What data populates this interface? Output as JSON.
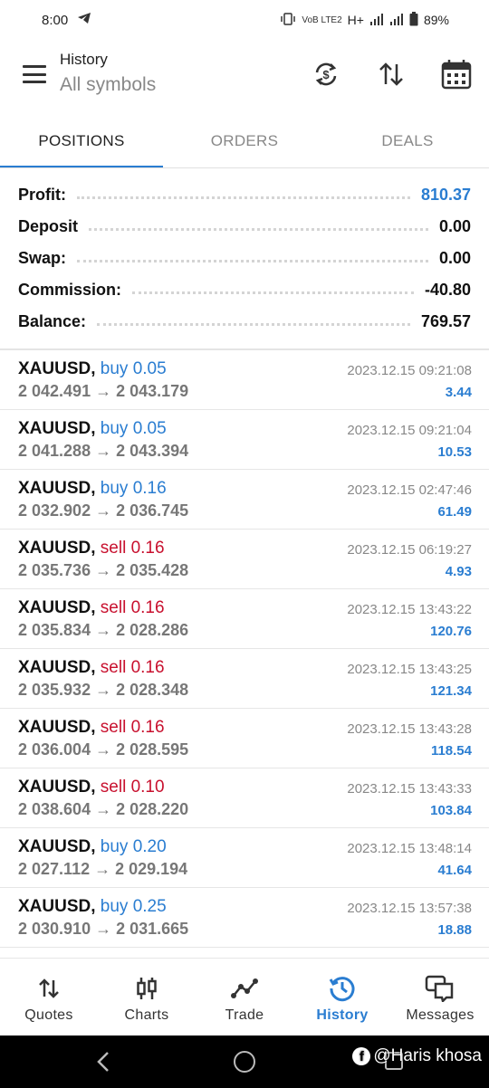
{
  "status_bar": {
    "time": "8:00",
    "net_small": "VoB LTE2",
    "net_type": "H+",
    "battery": "89%"
  },
  "header": {
    "title": "History",
    "subtitle": "All symbols"
  },
  "tabs": [
    {
      "label": "POSITIONS",
      "active": true
    },
    {
      "label": "ORDERS",
      "active": false
    },
    {
      "label": "DEALS",
      "active": false
    }
  ],
  "summary": {
    "profit": {
      "label": "Profit:",
      "value": "810.37"
    },
    "deposit": {
      "label": "Deposit",
      "value": "0.00"
    },
    "swap": {
      "label": "Swap:",
      "value": "0.00"
    },
    "commission": {
      "label": "Commission:",
      "value": "-40.80"
    },
    "balance": {
      "label": "Balance:",
      "value": "769.57"
    }
  },
  "positions": [
    {
      "symbol": "XAUUSD,",
      "side": "buy 0.05",
      "prices": "2 042.491 → 2 043.179",
      "time": "2023.12.15 09:21:08",
      "profit": "3.44"
    },
    {
      "symbol": "XAUUSD,",
      "side": "buy 0.05",
      "prices": "2 041.288 → 2 043.394",
      "time": "2023.12.15 09:21:04",
      "profit": "10.53"
    },
    {
      "symbol": "XAUUSD,",
      "side": "buy 0.16",
      "prices": "2 032.902 → 2 036.745",
      "time": "2023.12.15 02:47:46",
      "profit": "61.49"
    },
    {
      "symbol": "XAUUSD,",
      "side": "sell 0.16",
      "prices": "2 035.736 → 2 035.428",
      "time": "2023.12.15 06:19:27",
      "profit": "4.93"
    },
    {
      "symbol": "XAUUSD,",
      "side": "sell 0.16",
      "prices": "2 035.834 → 2 028.286",
      "time": "2023.12.15 13:43:22",
      "profit": "120.76"
    },
    {
      "symbol": "XAUUSD,",
      "side": "sell 0.16",
      "prices": "2 035.932 → 2 028.348",
      "time": "2023.12.15 13:43:25",
      "profit": "121.34"
    },
    {
      "symbol": "XAUUSD,",
      "side": "sell 0.16",
      "prices": "2 036.004 → 2 028.595",
      "time": "2023.12.15 13:43:28",
      "profit": "118.54"
    },
    {
      "symbol": "XAUUSD,",
      "side": "sell 0.10",
      "prices": "2 038.604 → 2 028.220",
      "time": "2023.12.15 13:43:33",
      "profit": "103.84"
    },
    {
      "symbol": "XAUUSD,",
      "side": "buy 0.20",
      "prices": "2 027.112 → 2 029.194",
      "time": "2023.12.15 13:48:14",
      "profit": "41.64"
    },
    {
      "symbol": "XAUUSD,",
      "side": "buy 0.25",
      "prices": "2 030.910 → 2 031.665",
      "time": "2023.12.15 13:57:38",
      "profit": "18.88"
    }
  ],
  "bottom_nav": [
    {
      "label": "Quotes",
      "icon": "quotes-arrows-icon",
      "active": false
    },
    {
      "label": "Charts",
      "icon": "candlestick-icon",
      "active": false
    },
    {
      "label": "Trade",
      "icon": "trend-line-icon",
      "active": false
    },
    {
      "label": "History",
      "icon": "history-clock-icon",
      "active": true
    },
    {
      "label": "Messages",
      "icon": "chat-bubbles-icon",
      "active": false
    }
  ],
  "watermark": "@Haris khosa",
  "colors": {
    "accent": "#2a7dd1",
    "sell": "#c8102e"
  }
}
